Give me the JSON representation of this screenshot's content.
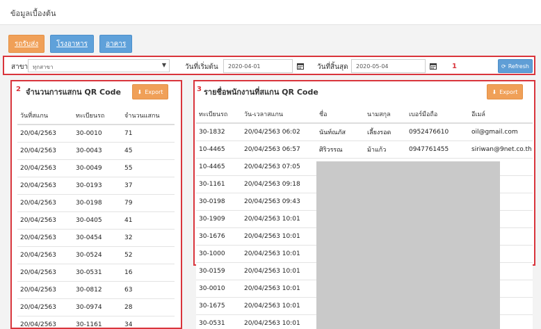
{
  "page": {
    "title": "ข้อมูลเบื้องต้น"
  },
  "tabs": [
    "รถรับส่ง",
    "โรงอาหาร",
    "อาคาร"
  ],
  "filter": {
    "branch_label": "สาขา",
    "branch_value": "ทุกสาขา",
    "start_label": "วันที่เริ่มต้น",
    "start_value": "2020-04-01",
    "end_label": "วันที่สิ้นสุด",
    "end_value": "2020-05-04",
    "refresh_label": "Refresh",
    "marker": "1"
  },
  "scan_count": {
    "marker": "2",
    "title": "จำนวนการแสกน QR Code",
    "export_label": "Export",
    "headers": [
      "วันที่สแกน",
      "ทะเบียนรถ",
      "จำนวนแสกน"
    ],
    "rows": [
      [
        "20/04/2563",
        "30-0010",
        "71"
      ],
      [
        "20/04/2563",
        "30-0043",
        "45"
      ],
      [
        "20/04/2563",
        "30-0049",
        "55"
      ],
      [
        "20/04/2563",
        "30-0193",
        "37"
      ],
      [
        "20/04/2563",
        "30-0198",
        "79"
      ],
      [
        "20/04/2563",
        "30-0405",
        "41"
      ],
      [
        "20/04/2563",
        "30-0454",
        "32"
      ],
      [
        "20/04/2563",
        "30-0524",
        "52"
      ],
      [
        "20/04/2563",
        "30-0531",
        "16"
      ],
      [
        "20/04/2563",
        "30-0812",
        "63"
      ],
      [
        "20/04/2563",
        "30-0974",
        "28"
      ],
      [
        "20/04/2563",
        "30-1161",
        "34"
      ]
    ]
  },
  "employee_scan": {
    "marker": "3",
    "title": "รายชื่อพนักงานที่สแกน QR Code",
    "export_label": "Export",
    "headers": [
      "ทะเบียนรถ",
      "วัน-เวลาสแกน",
      "ชื่อ",
      "นามสกุล",
      "เบอร์มือถือ",
      "อีเมล์"
    ],
    "rows": [
      [
        "30-1832",
        "20/04/2563 06:02",
        "นันท์ณภัส",
        "เลี้ยงรอด",
        "0952476610",
        "oil@gmail.com"
      ],
      [
        "10-4465",
        "20/04/2563 06:57",
        "ศิริวรรณ",
        "ม้าแก้ว",
        "0947761455",
        "siriwan@9net.co.th"
      ],
      [
        "10-4465",
        "20/04/2563 07:05",
        "",
        "",
        "",
        ""
      ],
      [
        "30-1161",
        "20/04/2563 09:18",
        "",
        "",
        "",
        ""
      ],
      [
        "30-0198",
        "20/04/2563 09:43",
        "",
        "",
        "",
        ""
      ],
      [
        "30-1909",
        "20/04/2563 10:01",
        "",
        "",
        "",
        ""
      ],
      [
        "30-1676",
        "20/04/2563 10:01",
        "",
        "",
        "",
        ""
      ],
      [
        "30-1000",
        "20/04/2563 10:01",
        "",
        "",
        "",
        ""
      ],
      [
        "30-0159",
        "20/04/2563 10:01",
        "",
        "",
        "",
        ""
      ],
      [
        "30-0010",
        "20/04/2563 10:01",
        "",
        "",
        "",
        ""
      ],
      [
        "30-1675",
        "20/04/2563 10:01",
        "",
        "",
        "",
        ""
      ],
      [
        "30-0531",
        "20/04/2563 10:01",
        "",
        "",
        "",
        ""
      ]
    ]
  },
  "colors": {
    "annotation_red": "#d9343b",
    "orange_button": "#f0a058",
    "blue_button": "#5fa1da"
  }
}
